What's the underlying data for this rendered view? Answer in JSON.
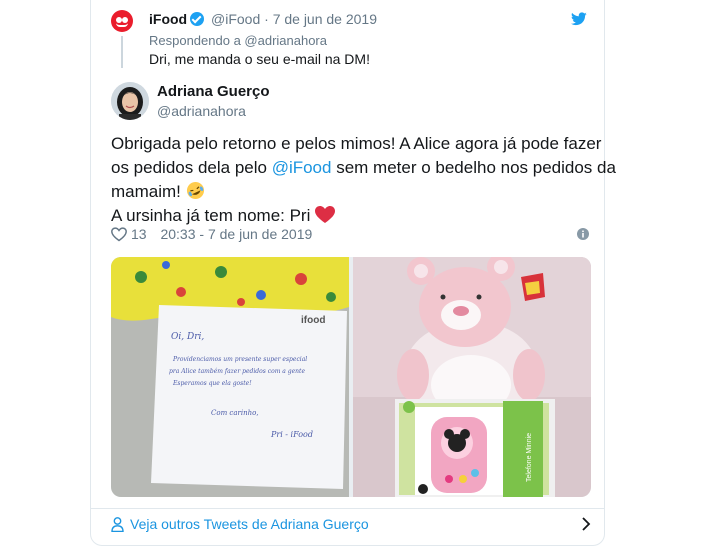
{
  "reply": {
    "name": "iFood",
    "handle": "@iFood",
    "separator": "·",
    "date": "7 de jun de 2019",
    "replying_to": "Respondendo a @adrianahora",
    "text": "Dri, me manda o seu e-mail na DM!"
  },
  "tweet": {
    "author_name": "Adriana Guerço",
    "author_handle": "@adrianahora",
    "line1": "Obrigada pelo retorno e pelos mimos! A Alice agora já pode fazer",
    "line2_pre": "os pedidos dela pelo ",
    "line2_mention": "@iFood",
    "line2_post": " sem meter o bedelho nos pedidos da",
    "line3": "mamaim! ",
    "line4": "A ursinha já tem nome: Pri ",
    "likes": "13",
    "timestamp": "20:33 - 7 de jun de 2019"
  },
  "photos": {
    "note_logo": "ifood",
    "note_lines": [
      "Oi, Dri,",
      "Providenciamos um presente super especial",
      "pra Alice também fazer pedidos com a gente",
      "Esperamos que ela goste!",
      "Com carinho,",
      "Pri - iFood"
    ],
    "phone_label": "Telefone Minnie"
  },
  "footer": {
    "more_tweets": "Veja outros Tweets de Adriana Guerço"
  },
  "colors": {
    "link": "#1b95e0",
    "muted": "#657786",
    "brand": "#ea1d2c",
    "heart": "#e0245e"
  }
}
